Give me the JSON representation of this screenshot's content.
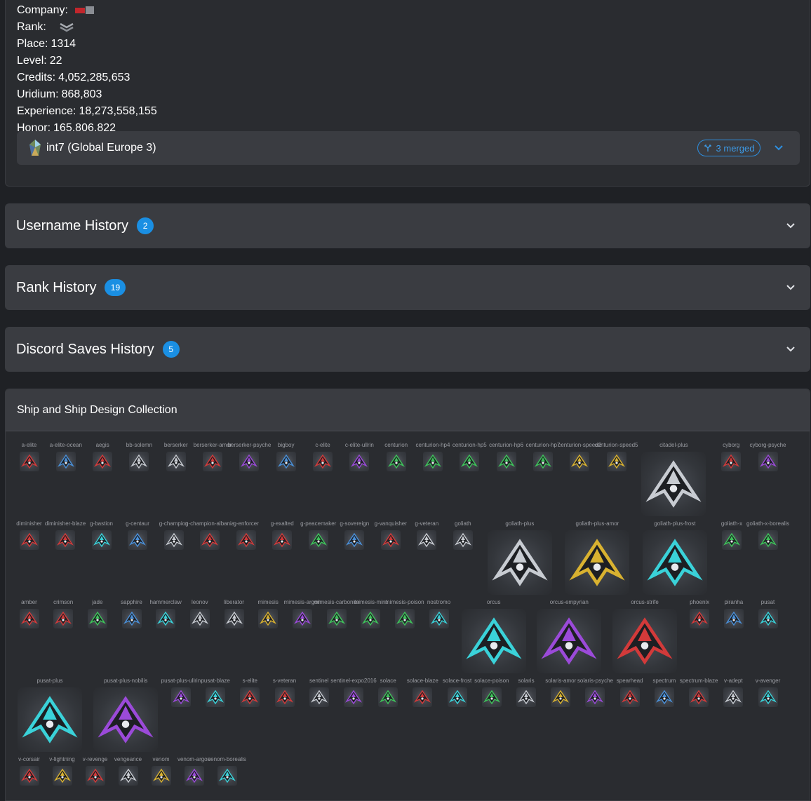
{
  "profile": {
    "company_label": "Company:",
    "rank_label": "Rank:",
    "stats": [
      {
        "label": "Place:",
        "value": "1314"
      },
      {
        "label": "Level:",
        "value": "22"
      },
      {
        "label": "Credits:",
        "value": "4,052,285,653"
      },
      {
        "label": "Uridium:",
        "value": "868,803"
      },
      {
        "label": "Experience:",
        "value": "18,273,558,155"
      },
      {
        "label": "Honor:",
        "value": "165,806,822"
      }
    ],
    "server": {
      "name": "int7 (Global Europe 3)",
      "merged": "3 merged"
    }
  },
  "accordions": [
    {
      "title": "Username History",
      "count": "2"
    },
    {
      "title": "Rank History",
      "count": "19"
    },
    {
      "title": "Discord Saves History",
      "count": "5"
    }
  ],
  "ships": {
    "title": "Ship and Ship Design Collection",
    "colors": {
      "red": "#d23a3a",
      "blue": "#4a90d9",
      "green": "#3ec45a",
      "gold": "#d9b230",
      "purple": "#9b4ad9",
      "cyan": "#3ad2d9",
      "silver": "#c8ccd2",
      "dark": "#2a2d33"
    },
    "rows": [
      [
        {
          "name": "a-elite",
          "color": "red"
        },
        {
          "name": "a-elite-ocean",
          "color": "blue"
        },
        {
          "name": "aegis",
          "color": "red"
        },
        {
          "name": "bb-solemn",
          "color": "silver"
        },
        {
          "name": "berserker",
          "color": "silver"
        },
        {
          "name": "berserker-amor",
          "color": "red"
        },
        {
          "name": "berserker-psyche",
          "color": "purple"
        },
        {
          "name": "bigboy",
          "color": "blue"
        },
        {
          "name": "c-elite",
          "color": "red"
        },
        {
          "name": "c-elite-ullrin",
          "color": "purple"
        },
        {
          "name": "centurion",
          "color": "green"
        },
        {
          "name": "centurion-hp4",
          "color": "green"
        },
        {
          "name": "centurion-hp5",
          "color": "green"
        },
        {
          "name": "centurion-hp6",
          "color": "green"
        },
        {
          "name": "centurion-hp7",
          "color": "green"
        },
        {
          "name": "centurion-speed2",
          "color": "gold"
        },
        {
          "name": "centurion-speed5",
          "color": "gold"
        },
        {
          "name": "citadel-plus",
          "color": "silver",
          "big": true
        },
        {
          "name": "cyborg",
          "color": "red"
        },
        {
          "name": "cyborg-psyche",
          "color": "purple"
        }
      ],
      [
        {
          "name": "diminisher",
          "color": "red"
        },
        {
          "name": "diminisher-blaze",
          "color": "red"
        },
        {
          "name": "g-bastion",
          "color": "cyan"
        },
        {
          "name": "g-centaur",
          "color": "blue"
        },
        {
          "name": "g-champion",
          "color": "silver"
        },
        {
          "name": "g-champion-albania",
          "color": "red"
        },
        {
          "name": "g-enforcer",
          "color": "red"
        },
        {
          "name": "g-exalted",
          "color": "red"
        },
        {
          "name": "g-peacemaker",
          "color": "green"
        },
        {
          "name": "g-sovereign",
          "color": "blue"
        },
        {
          "name": "g-vanquisher",
          "color": "red"
        },
        {
          "name": "g-veteran",
          "color": "silver"
        },
        {
          "name": "goliath",
          "color": "silver"
        },
        {
          "name": "goliath-plus",
          "color": "silver",
          "big": true
        },
        {
          "name": "goliath-plus-amor",
          "color": "gold",
          "big": true
        },
        {
          "name": "goliath-plus-frost",
          "color": "cyan",
          "big": true
        },
        {
          "name": "goliath-x",
          "color": "green"
        },
        {
          "name": "goliath-x-borealis",
          "color": "green"
        }
      ],
      [
        {
          "name": "amber",
          "color": "red"
        },
        {
          "name": "crimson",
          "color": "red"
        },
        {
          "name": "jade",
          "color": "green"
        },
        {
          "name": "sapphire",
          "color": "blue"
        },
        {
          "name": "hammerclaw",
          "color": "cyan"
        },
        {
          "name": "leonov",
          "color": "silver"
        },
        {
          "name": "liberator",
          "color": "silver"
        },
        {
          "name": "mimesis",
          "color": "gold"
        },
        {
          "name": "mimesis-argon",
          "color": "purple"
        },
        {
          "name": "mimesis-carbonite",
          "color": "green"
        },
        {
          "name": "mimesis-mint",
          "color": "green"
        },
        {
          "name": "mimesis-poison",
          "color": "green"
        },
        {
          "name": "nostromo",
          "color": "cyan"
        },
        {
          "name": "orcus",
          "color": "cyan",
          "big": true
        },
        {
          "name": "orcus-empyrian",
          "color": "purple",
          "big": true
        },
        {
          "name": "orcus-strife",
          "color": "red",
          "big": true
        },
        {
          "name": "phoenix",
          "color": "red"
        },
        {
          "name": "piranha",
          "color": "blue"
        },
        {
          "name": "pusat",
          "color": "cyan"
        }
      ],
      [
        {
          "name": "pusat-plus",
          "color": "cyan",
          "big": true
        },
        {
          "name": "pusat-plus-nobilis",
          "color": "purple",
          "big": true
        },
        {
          "name": "pusat-plus-ullrin",
          "color": "purple"
        },
        {
          "name": "pusat-blaze",
          "color": "cyan"
        },
        {
          "name": "s-elite",
          "color": "red"
        },
        {
          "name": "s-veteran",
          "color": "red"
        },
        {
          "name": "sentinel",
          "color": "silver"
        },
        {
          "name": "sentinel-expo2016",
          "color": "purple"
        },
        {
          "name": "solace",
          "color": "green"
        },
        {
          "name": "solace-blaze",
          "color": "red"
        },
        {
          "name": "solace-frost",
          "color": "cyan"
        },
        {
          "name": "solace-poison",
          "color": "green"
        },
        {
          "name": "solaris",
          "color": "silver"
        },
        {
          "name": "solaris-amor",
          "color": "gold"
        },
        {
          "name": "solaris-psyche",
          "color": "purple"
        },
        {
          "name": "spearhead",
          "color": "red"
        },
        {
          "name": "spectrum",
          "color": "blue"
        },
        {
          "name": "spectrum-blaze",
          "color": "red"
        },
        {
          "name": "v-adept",
          "color": "silver"
        },
        {
          "name": "v-avenger",
          "color": "cyan"
        }
      ],
      [
        {
          "name": "v-corsair",
          "color": "red"
        },
        {
          "name": "v-lightning",
          "color": "gold"
        },
        {
          "name": "v-revenge",
          "color": "red"
        },
        {
          "name": "vengeance",
          "color": "silver"
        },
        {
          "name": "venom",
          "color": "gold"
        },
        {
          "name": "venom-argon",
          "color": "purple"
        },
        {
          "name": "venom-borealis",
          "color": "cyan"
        }
      ]
    ]
  }
}
